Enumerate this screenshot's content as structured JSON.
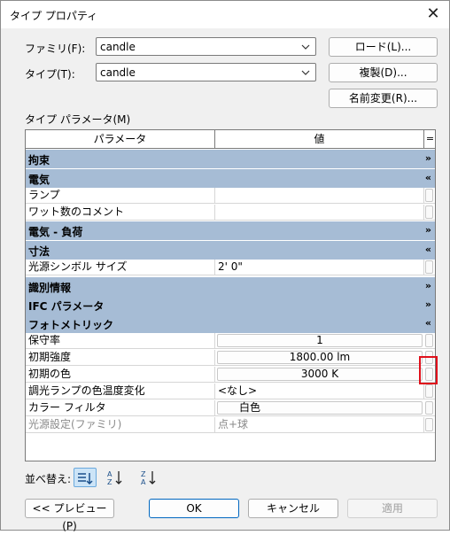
{
  "window": {
    "title": "タイプ プロパティ"
  },
  "family": {
    "label": "ファミリ(F):",
    "value": "candle"
  },
  "type": {
    "label": "タイプ(T):",
    "value": "candle"
  },
  "buttons": {
    "load": "ロード(L)...",
    "duplicate": "複製(D)...",
    "rename": "名前変更(R)..."
  },
  "type_params_label": "タイプ パラメータ(M)",
  "grid": {
    "headers": {
      "param": "パラメータ",
      "value": "値",
      "edit": "="
    },
    "groups": {
      "constraints": "拘束",
      "electrical": "電気",
      "electrical_load": "電気 - 負荷",
      "dimensions": "寸法",
      "identity": "識別情報",
      "ifc": "IFC パラメータ",
      "photometrics": "フォトメトリック"
    },
    "rows": {
      "lamp": {
        "name": "ランプ",
        "value": ""
      },
      "wattage_comment": {
        "name": "ワット数のコメント",
        "value": ""
      },
      "light_source_symbol_size": {
        "name": "光源シンボル サイズ",
        "value": "2'  0\""
      },
      "light_loss_factor": {
        "name": "保守率",
        "value": "1"
      },
      "initial_intensity": {
        "name": "初期強度",
        "value": "1800.00 lm"
      },
      "initial_color": {
        "name": "初期の色",
        "value": "3000 K"
      },
      "dimming_color_shift": {
        "name": "調光ランプの色温度変化",
        "value": "<なし>"
      },
      "color_filter": {
        "name": "カラー フィルタ",
        "value": "白色"
      },
      "light_source_definition": {
        "name": "光源設定(ファミリ)",
        "value": "点+球"
      }
    }
  },
  "sort": {
    "label": "並べ替え:"
  },
  "footer": {
    "preview": "<< プレビュー(P)",
    "ok": "OK",
    "cancel": "キャンセル",
    "apply": "適用"
  },
  "colors": {
    "group_band": "#a6bcd5",
    "highlight": "#e0101b",
    "accent": "#0067c0"
  }
}
